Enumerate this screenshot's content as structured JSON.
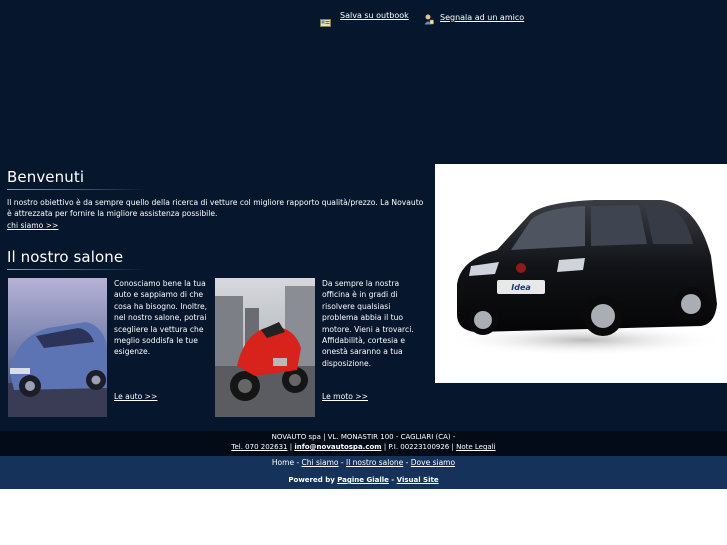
{
  "toplinks": {
    "save_outlook": "Salva su outbook",
    "tell_friend": "Segnala ad un amico"
  },
  "welcome": {
    "title": "Benvenuti",
    "text": "Il nostro obiettivo è da sempre quello della ricerca di vetture col migliore rapporto qualità/prezzo. La Novauto è attrezzata per fornire la migliore assistenza possibile.",
    "link": "chi siamo >>"
  },
  "salone": {
    "title": "Il nostro salone",
    "auto_text": "Conosciamo bene la tua auto e sappiamo di che cosa ha bisogno. Inoltre, nel nostro salone, potrai scegliere la vettura che meglio soddisfa le tue esigenze.",
    "auto_link": "Le auto >>",
    "moto_text": "Da sempre la nostra officina è in gradi di risolvere qualsiasi problema abbia il tuo motore. Vieni a trovarci. Affidabilità, cortesia e onestà saranno a tua disposizione.",
    "moto_link": "Le moto >>"
  },
  "car_badge": "Idea",
  "footer": {
    "address": "NOVAUTO spa | VL. MONASTIR 100 - CAGLIARI (CA) -",
    "tel": "Tel. 070 202631",
    "sep1": " | ",
    "email": "info@novautospa.com",
    "piva": " | P.I. 00223100926 | ",
    "legal": "Note Legali",
    "nav_home": "Home",
    "nav_sep": " - ",
    "nav_chi": "Chi siamo",
    "nav_salone": "Il nostro salone",
    "nav_dove": "Dove siamo",
    "powered": "Powered by ",
    "pagine": "Pagine Gialle",
    "dash": " - ",
    "visual": "Visual Site"
  },
  "colors": {
    "background": "#06162c",
    "footer_dark": "#030b17",
    "footer_blue": "#14325a",
    "moto_red": "#d8231d",
    "car_black": "#101114"
  }
}
